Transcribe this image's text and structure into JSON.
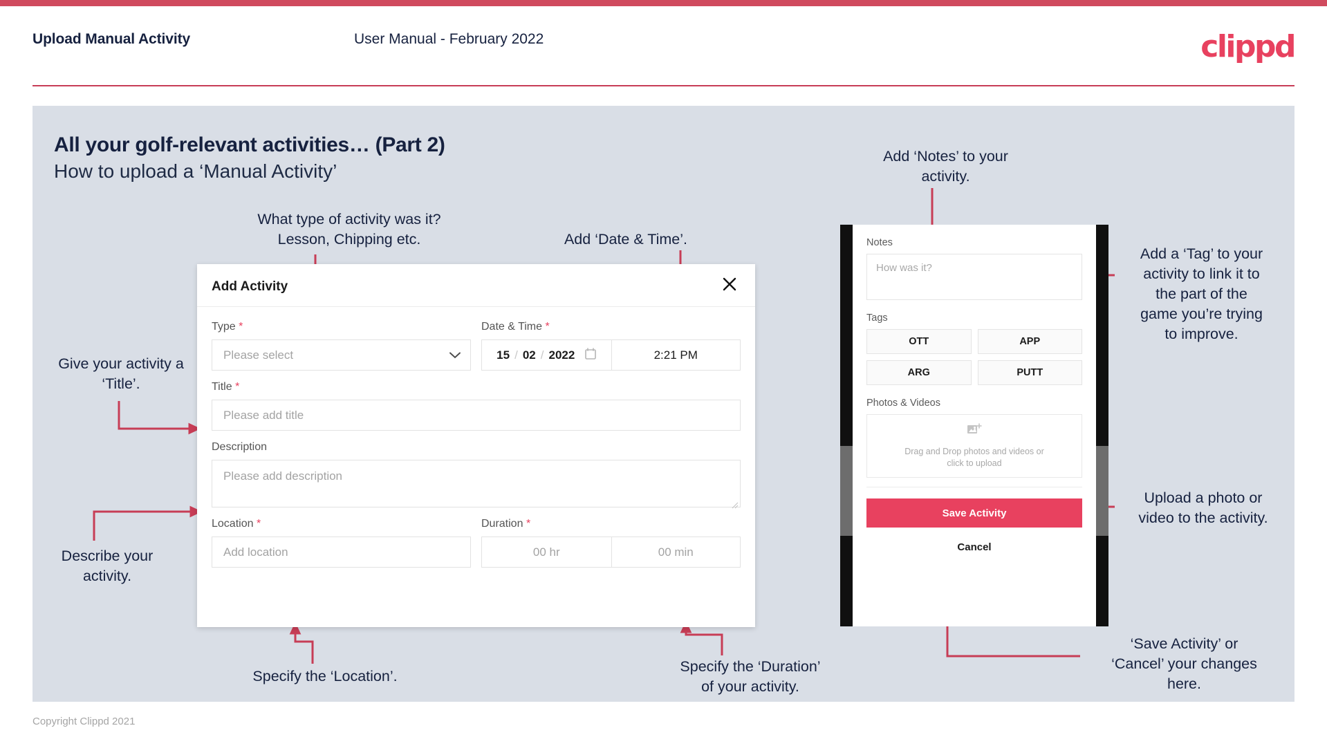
{
  "colors": {
    "brand_pink": "#e8415f",
    "top_bar": "#d04a5e",
    "slide_bg": "#d9dee6",
    "navy_text": "#16213f",
    "arrow": "#c73d56"
  },
  "header": {
    "title": "Upload Manual Activity",
    "subtitle": "User Manual - February 2022",
    "logo": "clippd"
  },
  "slide": {
    "title": "All your golf-relevant activities… (Part 2)",
    "subtitle": "How to upload a ‘Manual Activity’"
  },
  "dialog": {
    "title": "Add Activity",
    "close_icon": "close-icon",
    "fields": {
      "type": {
        "label": "Type",
        "required": "*",
        "placeholder": "Please select",
        "chevron": "chevron-down-icon"
      },
      "datetime": {
        "label": "Date & Time",
        "required": "*",
        "day": "15",
        "month": "02",
        "year": "2022",
        "sep": "/",
        "calendar_icon": "calendar-icon",
        "time": "2:21 PM"
      },
      "title": {
        "label": "Title",
        "required": "*",
        "placeholder": "Please add title"
      },
      "description": {
        "label": "Description",
        "placeholder": "Please add description"
      },
      "location": {
        "label": "Location",
        "required": "*",
        "placeholder": "Add location"
      },
      "duration": {
        "label": "Duration",
        "required": "*",
        "hours_placeholder": "00 hr",
        "minutes_placeholder": "00 min"
      }
    }
  },
  "phone": {
    "notes": {
      "label": "Notes",
      "placeholder": "How was it?"
    },
    "tags": {
      "label": "Tags",
      "items": [
        "OTT",
        "APP",
        "ARG",
        "PUTT"
      ]
    },
    "photos": {
      "label": "Photos & Videos",
      "icon": "add-image-icon",
      "drop_line1": "Drag and Drop photos and videos or",
      "drop_line2": "click to upload"
    },
    "save_label": "Save Activity",
    "cancel_label": "Cancel"
  },
  "annotations": {
    "type": "What type of activity was it?\nLesson, Chipping etc.",
    "datetime": "Add ‘Date & Time’.",
    "title": "Give your activity a\n‘Title’.",
    "description": "Describe your\nactivity.",
    "location": "Specify the ‘Location’.",
    "duration": "Specify the ‘Duration’\nof your activity.",
    "notes": "Add ‘Notes’ to your\nactivity.",
    "tags": "Add a ‘Tag’ to your\nactivity to link it to\nthe part of the\ngame you’re trying\nto improve.",
    "upload": "Upload a photo or\nvideo to the activity.",
    "save": "‘Save Activity’ or\n‘Cancel’ your changes\nhere."
  },
  "footer": {
    "copyright": "Copyright Clippd 2021"
  }
}
